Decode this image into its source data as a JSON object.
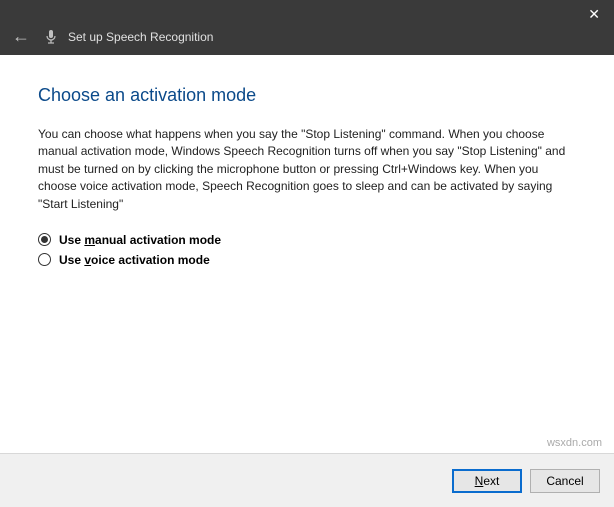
{
  "window": {
    "title": "Set up Speech Recognition"
  },
  "main": {
    "heading": "Choose an activation mode",
    "description": "You can choose what happens when you say the \"Stop Listening\" command.\nWhen you choose manual activation mode, Windows Speech Recognition turns off when you say \"Stop Listening\" and must be turned on by clicking the microphone button or pressing Ctrl+Windows key.\nWhen you choose voice activation mode, Speech Recognition goes to sleep and can be activated by saying \"Start Listening\""
  },
  "options": {
    "manual": {
      "prefix": "Use ",
      "key": "m",
      "rest": "anual activation mode",
      "selected": true
    },
    "voice": {
      "prefix": "Use ",
      "key": "v",
      "rest": "oice activation mode",
      "selected": false
    }
  },
  "buttons": {
    "next": {
      "key": "N",
      "rest": "ext"
    },
    "cancel": {
      "label": "Cancel"
    }
  },
  "watermark": "wsxdn.com"
}
